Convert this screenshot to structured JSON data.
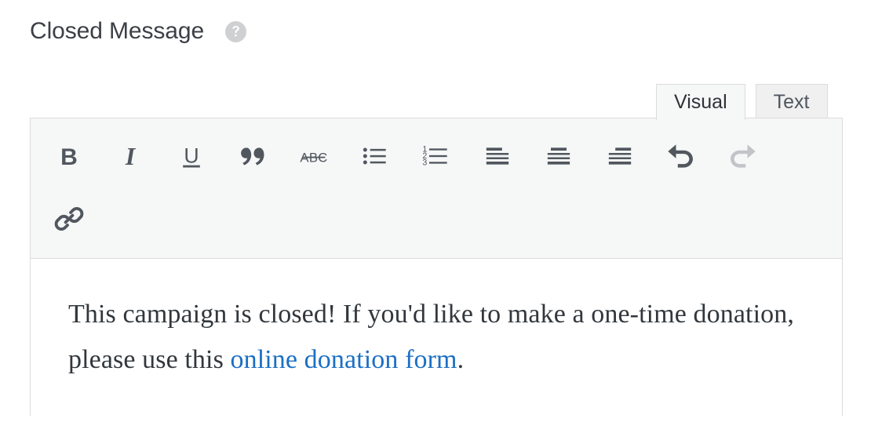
{
  "field": {
    "title": "Closed Message",
    "help_icon": "help-circle-icon",
    "help_icon_color": "#cfd0d2"
  },
  "editor": {
    "tabs": [
      {
        "id": "visual",
        "label": "Visual",
        "active": true
      },
      {
        "id": "text",
        "label": "Text",
        "active": false
      }
    ],
    "toolbar": {
      "rows": [
        [
          {
            "name": "bold-icon",
            "label": "B",
            "disabled": false
          },
          {
            "name": "italic-icon",
            "label": "I",
            "disabled": false
          },
          {
            "name": "underline-icon",
            "label": "U",
            "disabled": false
          },
          {
            "name": "blockquote-icon",
            "label": "“",
            "disabled": false
          },
          {
            "name": "strikethrough-icon",
            "label": "ABC",
            "disabled": false
          },
          {
            "name": "bulleted-list-icon",
            "label": "",
            "disabled": false
          },
          {
            "name": "numbered-list-icon",
            "label": "",
            "disabled": false
          },
          {
            "name": "align-left-icon",
            "label": "",
            "disabled": false
          },
          {
            "name": "align-center-icon",
            "label": "",
            "disabled": false
          },
          {
            "name": "align-right-icon",
            "label": "",
            "disabled": false
          },
          {
            "name": "undo-icon",
            "label": "",
            "disabled": false
          },
          {
            "name": "redo-icon",
            "label": "",
            "disabled": true
          }
        ],
        [
          {
            "name": "link-icon",
            "label": "",
            "disabled": false
          }
        ]
      ],
      "icon_color": "#50575e",
      "disabled_icon_color": "#c3c4c7"
    },
    "content": {
      "text_before_link": "This campaign is closed! If you'd like to make a one-time donation, please use this ",
      "link_text": "online donation form",
      "text_after_link": ".",
      "link_color": "#1b6fc4"
    }
  }
}
